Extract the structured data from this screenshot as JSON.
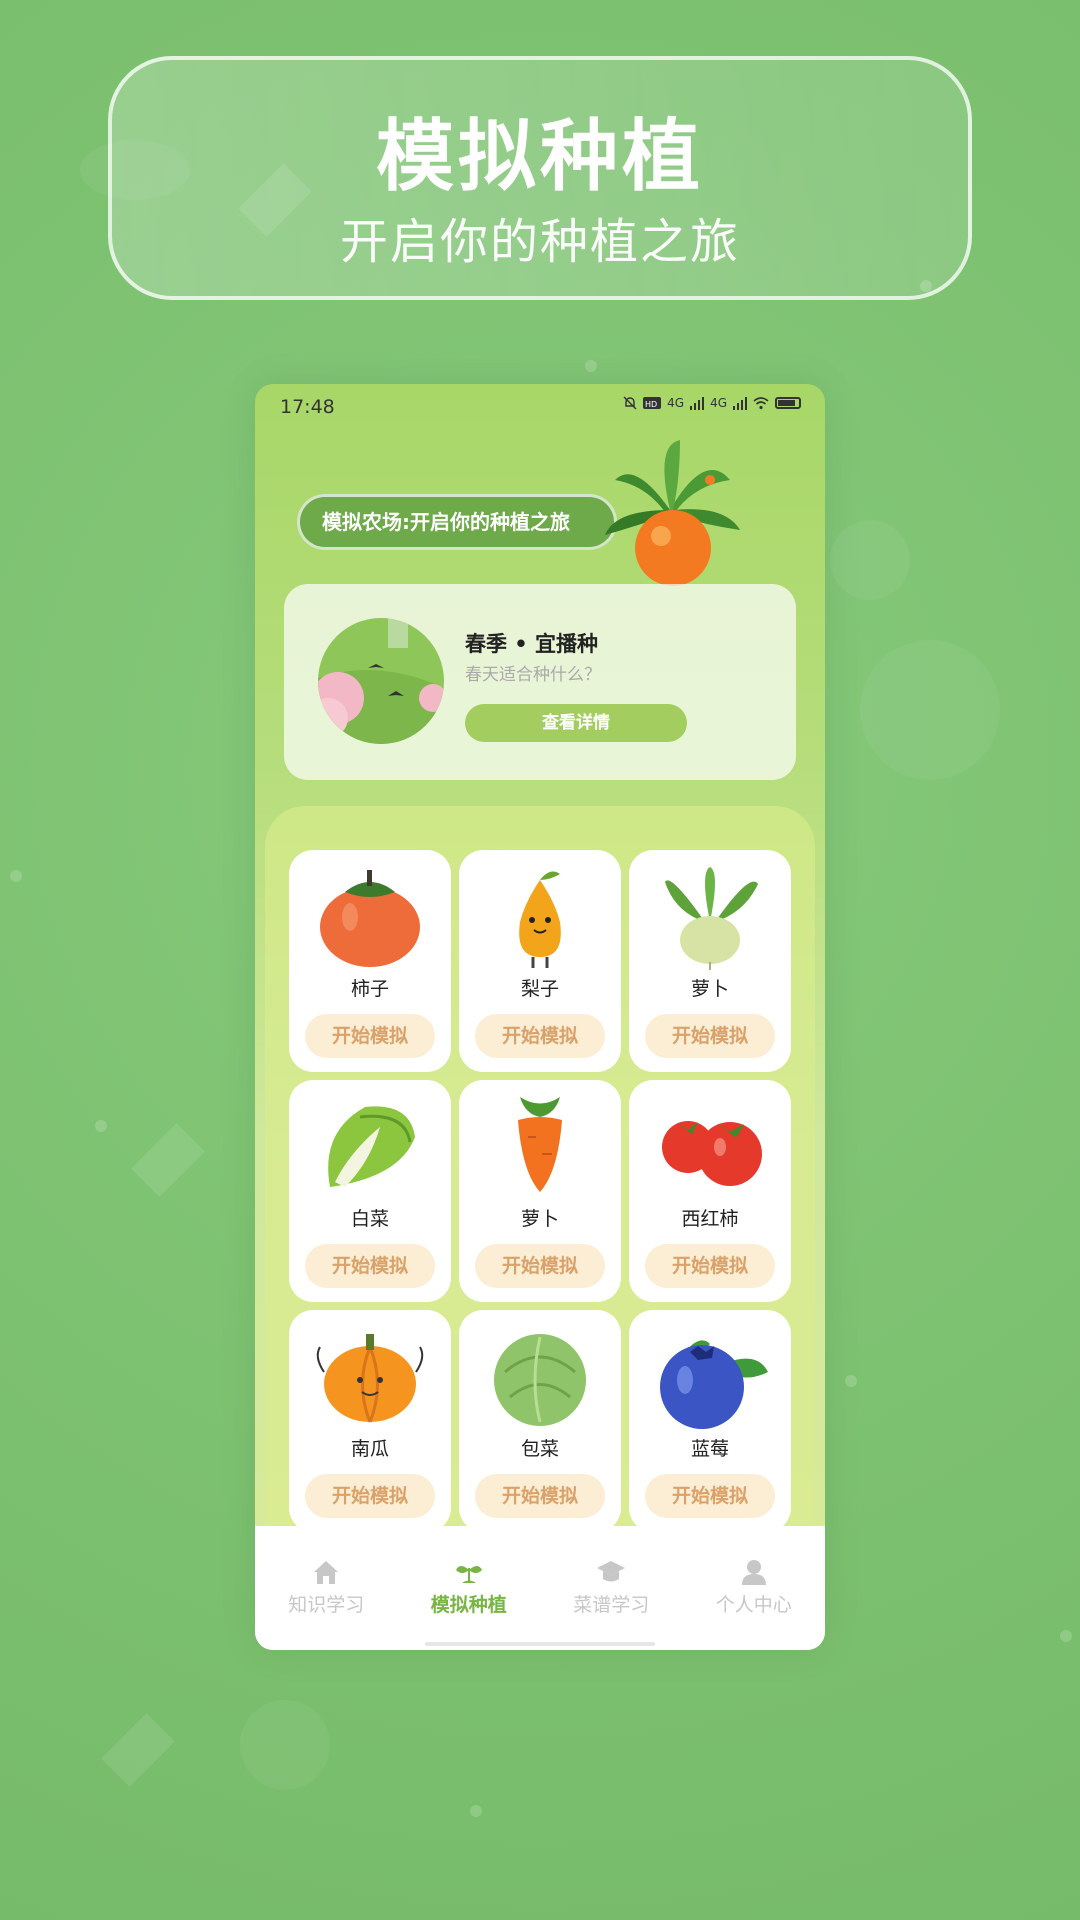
{
  "banner": {
    "title": "模拟种植",
    "subtitle": "开启你的种植之旅"
  },
  "status_bar": {
    "time": "17:48",
    "network_1": "4G",
    "network_2": "4G"
  },
  "header": {
    "pill_label": "模拟农场:开启你的种植之旅"
  },
  "season_card": {
    "title": "春季 • 宜播种",
    "subtitle": "春天适合种什么？",
    "button_label": "查看详情"
  },
  "plants": [
    {
      "name": "柿子",
      "button_label": "开始模拟"
    },
    {
      "name": "梨子",
      "button_label": "开始模拟"
    },
    {
      "name": "萝卜",
      "button_label": "开始模拟"
    },
    {
      "name": "白菜",
      "button_label": "开始模拟"
    },
    {
      "name": "萝卜",
      "button_label": "开始模拟"
    },
    {
      "name": "西红柿",
      "button_label": "开始模拟"
    },
    {
      "name": "南瓜",
      "button_label": "开始模拟"
    },
    {
      "name": "包菜",
      "button_label": "开始模拟"
    },
    {
      "name": "蓝莓",
      "button_label": "开始模拟"
    }
  ],
  "tabs": [
    {
      "label": "知识学习",
      "icon": "home-icon",
      "active": false
    },
    {
      "label": "模拟种植",
      "icon": "sprout-icon",
      "active": true
    },
    {
      "label": "菜谱学习",
      "icon": "graduation-cap-icon",
      "active": false
    },
    {
      "label": "个人中心",
      "icon": "person-icon",
      "active": false
    }
  ],
  "colors": {
    "accent_green": "#79b545",
    "button_peach": "#fbeed4",
    "button_text": "#dba16a",
    "background": "#7cc170"
  }
}
